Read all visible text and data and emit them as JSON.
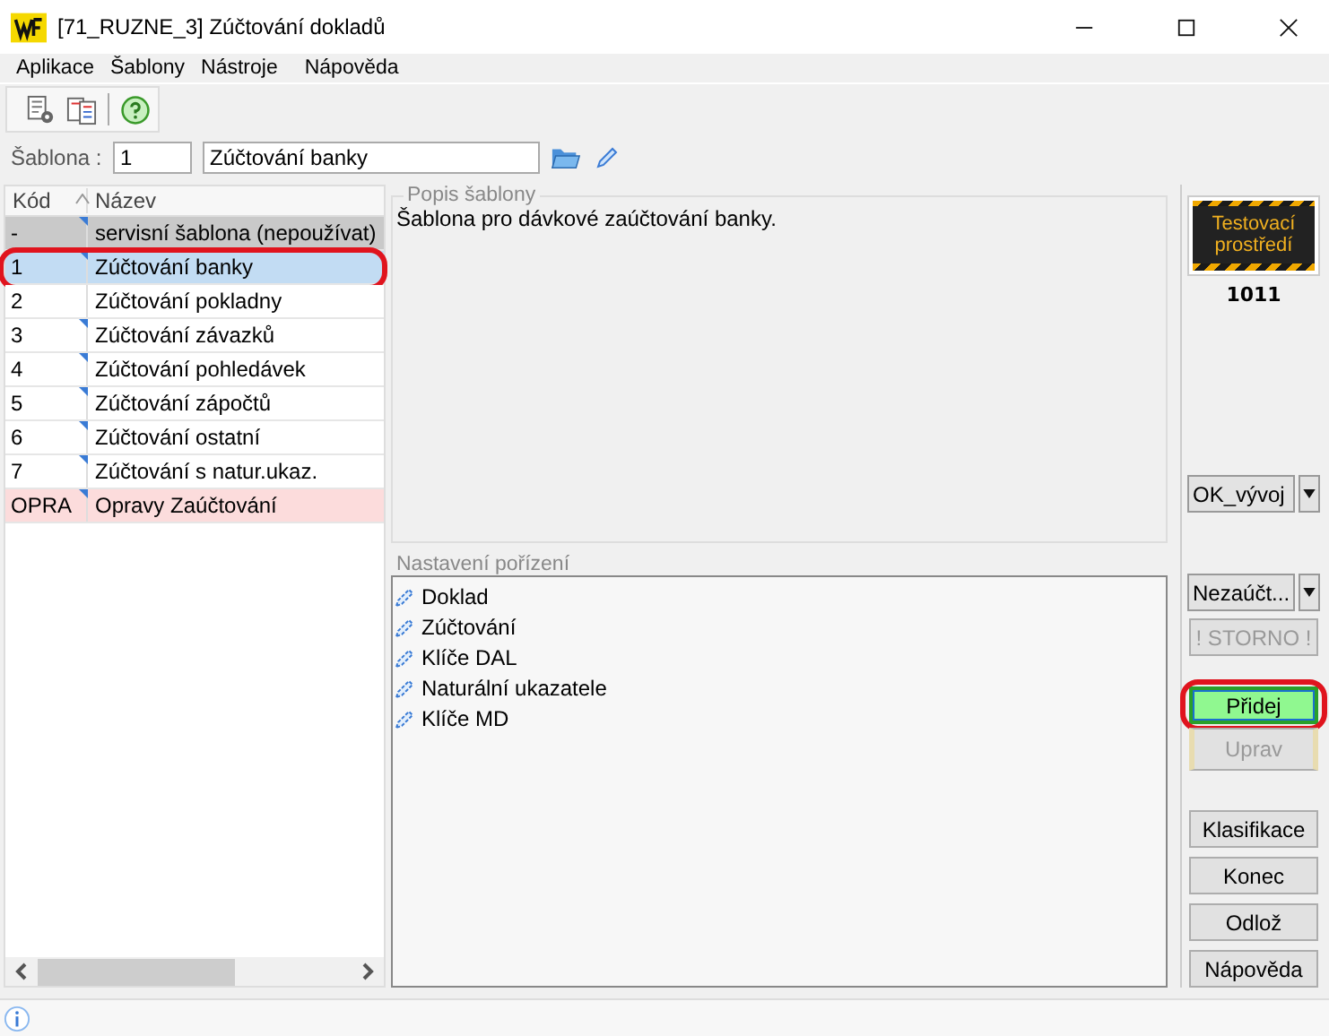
{
  "window": {
    "title": "[71_RUZNE_3] Zúčtování dokladů"
  },
  "menu": [
    "Aplikace",
    "Šablony",
    "Nástroje",
    "Nápověda"
  ],
  "template": {
    "label": "Šablona :",
    "code": "1",
    "name": "Zúčtování banky"
  },
  "table": {
    "columns": [
      "Kód",
      "Název"
    ],
    "rows": [
      {
        "code": "-",
        "name": "servisní šablona (nepoužívat)",
        "kind": "service",
        "flag": true,
        "selected": false,
        "highlighted": false
      },
      {
        "code": "1",
        "name": "Zúčtování banky",
        "kind": "normal",
        "flag": true,
        "selected": true,
        "highlighted": true
      },
      {
        "code": "2",
        "name": "Zúčtování pokladny",
        "kind": "normal",
        "flag": false,
        "selected": false,
        "highlighted": false
      },
      {
        "code": "3",
        "name": "Zúčtování závazků",
        "kind": "normal",
        "flag": true,
        "selected": false,
        "highlighted": false
      },
      {
        "code": "4",
        "name": "Zúčtování pohledávek",
        "kind": "normal",
        "flag": true,
        "selected": false,
        "highlighted": false
      },
      {
        "code": "5",
        "name": "Zúčtování zápočtů",
        "kind": "normal",
        "flag": true,
        "selected": false,
        "highlighted": false
      },
      {
        "code": "6",
        "name": "Zúčtování ostatní",
        "kind": "normal",
        "flag": true,
        "selected": false,
        "highlighted": false
      },
      {
        "code": "7",
        "name": "Zúčtování s natur.ukaz.",
        "kind": "normal",
        "flag": true,
        "selected": false,
        "highlighted": false
      },
      {
        "code": "OPRA",
        "name": "Opravy Zaúčtování",
        "kind": "correction",
        "flag": true,
        "selected": false,
        "highlighted": false
      }
    ]
  },
  "description": {
    "legend": "Popis šablony",
    "text": "Šablona pro dávkové zaúčtování banky."
  },
  "settings": {
    "legend": "Nastavení pořízení",
    "items": [
      "Doklad",
      "Zúčtování",
      "Klíče DAL",
      "Naturální ukazatele",
      "Klíče MD"
    ]
  },
  "badge": {
    "text": "Testovací prostředí",
    "number": "1011"
  },
  "selects": [
    {
      "value": "OK_vývoj"
    },
    {
      "value": "Nezaúčt..."
    }
  ],
  "buttons": [
    {
      "label": "! STORNO !",
      "kind": "plain",
      "disabled": true,
      "highlighted": false
    },
    {
      "label": "Přidej",
      "kind": "primary",
      "disabled": false,
      "highlighted": true
    },
    {
      "label": "Uprav",
      "kind": "edit",
      "disabled": true,
      "highlighted": false
    }
  ],
  "footer_buttons": [
    {
      "label": "Klasifikace"
    },
    {
      "label": "Konec"
    },
    {
      "label": "Odlož"
    },
    {
      "label": "Nápověda"
    }
  ]
}
